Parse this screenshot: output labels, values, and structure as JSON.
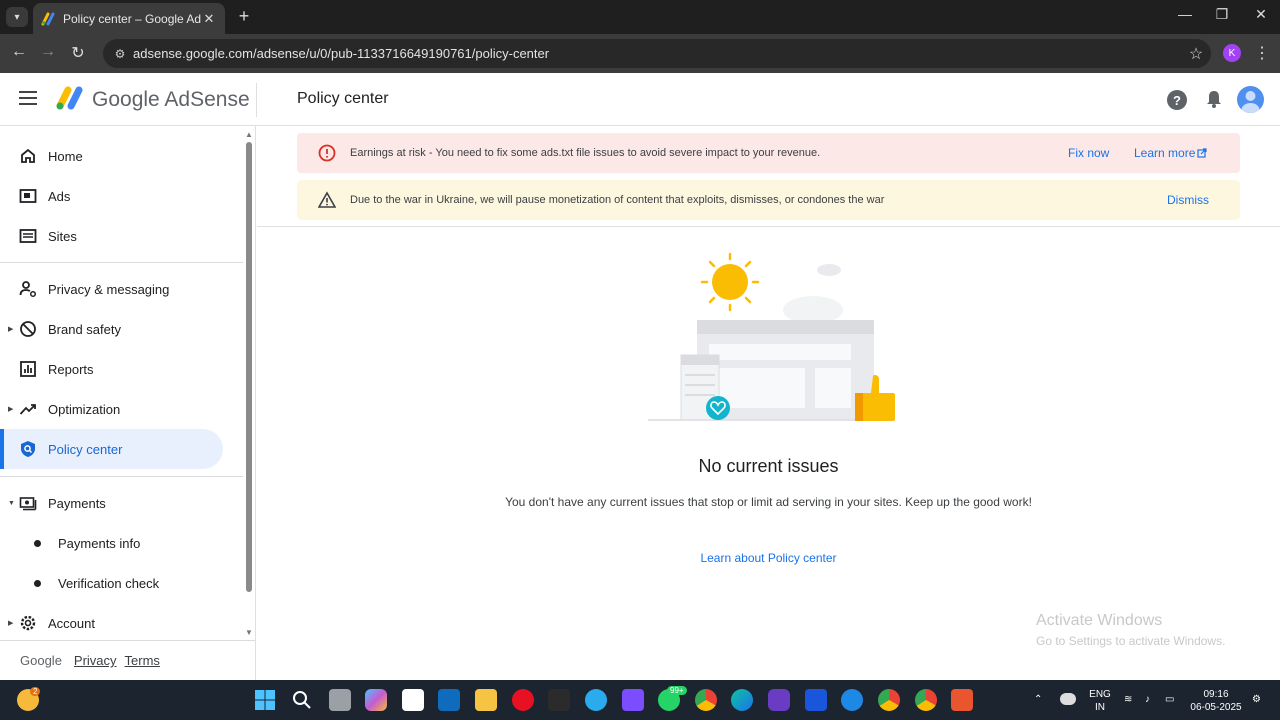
{
  "browser": {
    "tab_title": "Policy center – Google AdSense",
    "url": "adsense.google.com/adsense/u/0/pub-1133716649190761/policy-center",
    "profile_initial": "K"
  },
  "header": {
    "logo_text": "Google AdSense",
    "page_title": "Policy center"
  },
  "sidebar": {
    "items": [
      {
        "label": "Home"
      },
      {
        "label": "Ads"
      },
      {
        "label": "Sites"
      },
      {
        "label": "Privacy & messaging"
      },
      {
        "label": "Brand safety"
      },
      {
        "label": "Reports"
      },
      {
        "label": "Optimization"
      },
      {
        "label": "Policy center"
      },
      {
        "label": "Payments"
      },
      {
        "label": "Payments info"
      },
      {
        "label": "Verification check"
      },
      {
        "label": "Account"
      }
    ],
    "footer": {
      "brand": "Google",
      "privacy": "Privacy",
      "terms": "Terms"
    }
  },
  "banners": {
    "error": {
      "text": "Earnings at risk - You need to fix some ads.txt file issues to avoid severe impact to your revenue.",
      "fix": "Fix now",
      "learn": "Learn more"
    },
    "warning": {
      "text": "Due to the war in Ukraine, we will pause monetization of content that exploits, dismisses, or condones the war",
      "dismiss": "Dismiss"
    }
  },
  "main": {
    "empty_title": "No current issues",
    "empty_desc": "You don't have any current issues that stop or limit ad serving in your sites. Keep up the good work!",
    "learn_link": "Learn about Policy center"
  },
  "watermark": {
    "line1": "Activate Windows",
    "line2": "Go to Settings to activate Windows."
  },
  "taskbar": {
    "lang1": "ENG",
    "lang2": "IN",
    "time": "09:16",
    "date": "06-05-2025",
    "badge_weather": "2",
    "badge_whatsapp": "99+"
  },
  "colors": {
    "accent": "#1a73e8",
    "error_bg": "#fce8e6",
    "warn_bg": "#fef7e0",
    "error_icon": "#d93025"
  }
}
